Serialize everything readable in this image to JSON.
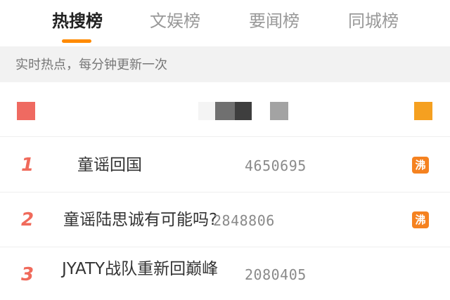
{
  "tabs": [
    {
      "label": "热搜榜"
    },
    {
      "label": "文娱榜"
    },
    {
      "label": "要闻榜"
    },
    {
      "label": "同城榜"
    }
  ],
  "subheader": {
    "text": "实时热点，每分钟更新一次"
  },
  "list": [
    {
      "rank": "1",
      "title": "童谣回国",
      "count": "4650695",
      "badge": "沸"
    },
    {
      "rank": "2",
      "title": "童谣陆思诚有可能吗?",
      "count": "2848806",
      "badge": "沸"
    },
    {
      "rank": "3",
      "title": "JYATY战队重新回巅峰",
      "count": "2080405"
    }
  ],
  "colors": {
    "accent": "#ff8a00",
    "rank": "#f06a5b",
    "hot_badge": "#f58220",
    "top_left_block": "#ef6a61",
    "top_right_block": "#f5a020"
  }
}
